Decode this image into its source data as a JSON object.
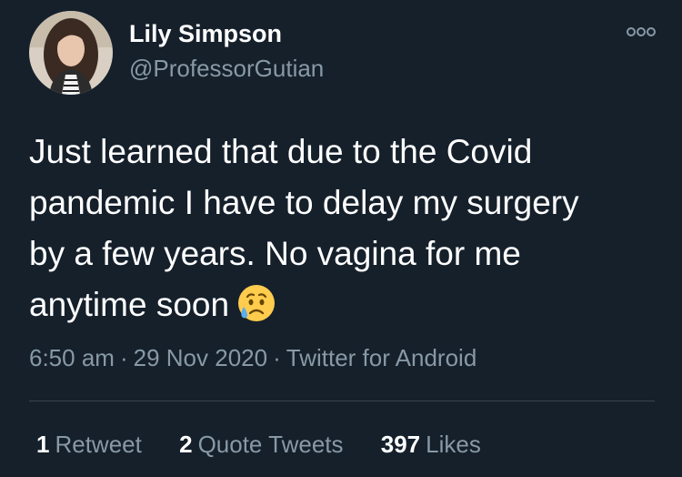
{
  "author": {
    "display_name": "Lily Simpson",
    "handle": "@ProfessorGutian",
    "avatar_icon": "profile-photo"
  },
  "more_icon": "more-options-icon",
  "tweet": {
    "lines": [
      "Just learned that due to the Covid",
      "pandemic I have to delay my surgery",
      "by a few years. No vagina for me",
      "anytime soon"
    ],
    "emoji": "sad-but-relieved-face"
  },
  "meta": {
    "time": "6:50 am",
    "separator": "·",
    "date": "29 Nov 2020",
    "source": "Twitter for Android"
  },
  "stats": {
    "retweets": {
      "count": "1",
      "label": "Retweet"
    },
    "quote_tweets": {
      "count": "2",
      "label": "Quote Tweets"
    },
    "likes": {
      "count": "397",
      "label": "Likes"
    }
  },
  "colors": {
    "background": "#15202b",
    "primary_text": "#ffffff",
    "secondary_text": "#8899a6",
    "divider": "#38444d"
  }
}
